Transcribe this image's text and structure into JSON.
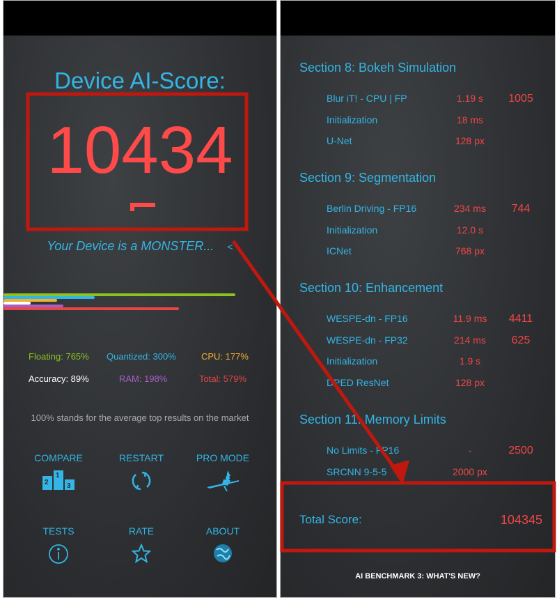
{
  "left": {
    "title": "Device AI-Score:",
    "score": "10434",
    "subtitle": "Your Device is a MONSTER...",
    "stats": [
      {
        "label": "Floating: 765%",
        "value": 765,
        "color": "#8dc21f"
      },
      {
        "label": "Quantized: 300%",
        "value": 300,
        "color": "#33b5e5"
      },
      {
        "label": "CPU: 177%",
        "value": 177,
        "color": "#f0b030"
      },
      {
        "label": "Accuracy: 89%",
        "value": 89,
        "color": "#ffffff"
      },
      {
        "label": "RAM: 198%",
        "value": 198,
        "color": "#a55fc9"
      },
      {
        "label": "Total: 579%",
        "value": 579,
        "color": "#e84545"
      }
    ],
    "note": "100% stands for the average top results on the market",
    "buttons": [
      {
        "label": "COMPARE",
        "icon": "podium-icon"
      },
      {
        "label": "RESTART",
        "icon": "refresh-icon"
      },
      {
        "label": "PRO MODE",
        "icon": "witch-icon"
      },
      {
        "label": "TESTS",
        "icon": "info-icon"
      },
      {
        "label": "RATE",
        "icon": "star-icon"
      },
      {
        "label": "ABOUT",
        "icon": "globe-icon"
      }
    ]
  },
  "right": {
    "sections": [
      {
        "title": "Section 8: Bokeh Simulation",
        "rows": [
          {
            "name": "Blur iT! - CPU | FP",
            "value": "1.19 s",
            "score": "1005"
          },
          {
            "name": "Initialization",
            "value": "18 ms",
            "score": ""
          },
          {
            "name": "U-Net",
            "value": "128 px",
            "score": ""
          }
        ]
      },
      {
        "title": "Section 9: Segmentation",
        "rows": [
          {
            "name": "Berlin Driving - FP16",
            "value": "234 ms",
            "score": "744"
          },
          {
            "name": "Initialization",
            "value": "12.0 s",
            "score": ""
          },
          {
            "name": "ICNet",
            "value": "768 px",
            "score": ""
          }
        ]
      },
      {
        "title": "Section 10: Enhancement",
        "rows": [
          {
            "name": "WESPE-dn - FP16",
            "value": "11.9 ms",
            "score": "4411"
          },
          {
            "name": "WESPE-dn - FP32",
            "value": "214 ms",
            "score": "625"
          },
          {
            "name": "Initialization",
            "value": "1.9 s",
            "score": ""
          },
          {
            "name": "DPED ResNet",
            "value": "128 px",
            "score": ""
          }
        ]
      },
      {
        "title": "Section 11: Memory Limits",
        "rows": [
          {
            "name": "No Limits - FP16",
            "value": "-",
            "score": "2500"
          },
          {
            "name": "SRCNN 9-5-5",
            "value": "2000 px",
            "score": ""
          }
        ]
      }
    ],
    "total_label": "Total Score:",
    "total_value": "104345",
    "whats_new": "AI BENCHMARK 3:  WHAT'S NEW?"
  },
  "annotation_color": "#c0180e"
}
